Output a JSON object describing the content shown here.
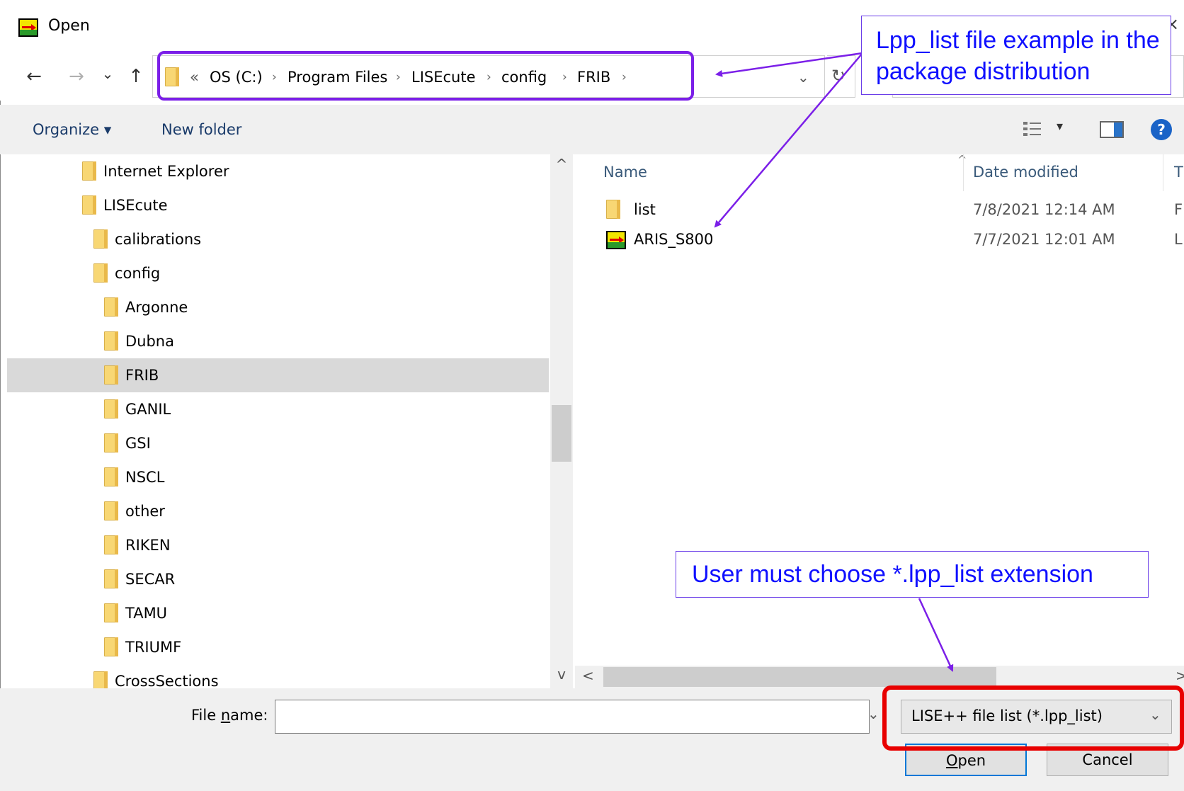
{
  "window": {
    "title": "Open",
    "close_glyph": "×"
  },
  "nav": {
    "back_glyph": "←",
    "forward_glyph": "→",
    "recent_glyph": "⌄",
    "up_glyph": "↑"
  },
  "address": {
    "overflow_glyph": "«",
    "separator_glyph": "›",
    "crumbs": [
      "OS (C:)",
      "Program Files",
      "LISEcute",
      "config",
      "FRIB"
    ],
    "dropdown_glyph": "⌄",
    "refresh_glyph": "↻"
  },
  "toolbar": {
    "organize_label": "Organize ▾",
    "new_folder_label": "New folder",
    "view_glyph": "▾",
    "help_glyph": "?"
  },
  "tree": {
    "items": [
      {
        "label": "Internet Explorer"
      },
      {
        "label": "LISEcute"
      },
      {
        "label": "calibrations"
      },
      {
        "label": "config"
      },
      {
        "label": "Argonne"
      },
      {
        "label": "Dubna"
      },
      {
        "label": "FRIB"
      },
      {
        "label": "GANIL"
      },
      {
        "label": "GSI"
      },
      {
        "label": "NSCL"
      },
      {
        "label": "other"
      },
      {
        "label": "RIKEN"
      },
      {
        "label": "SECAR"
      },
      {
        "label": "TAMU"
      },
      {
        "label": "TRIUMF"
      },
      {
        "label": "CrossSections"
      }
    ],
    "selected": "FRIB",
    "scroll_up_glyph": "^",
    "scroll_down_glyph": "v"
  },
  "files": {
    "columns": {
      "name": "Name",
      "date_modified": "Date modified",
      "type_partial": "T"
    },
    "sort_glyph": "^",
    "rows": [
      {
        "name": "list",
        "date": "7/8/2021 12:14 AM",
        "type_partial": "F",
        "icon": "folder-icon"
      },
      {
        "name": "ARIS_S800",
        "date": "7/7/2021 12:01 AM",
        "type_partial": "L",
        "icon": "lise-file-icon"
      }
    ],
    "hscroll_left_glyph": "<",
    "hscroll_right_glyph": ">"
  },
  "bottom": {
    "filename_label_pre": "File ",
    "filename_label_u": "n",
    "filename_label_post": "ame:",
    "filename_value": "",
    "filename_dropdown_glyph": "⌄",
    "filetype_value": "LISE++ file list (*.lpp_list)",
    "filetype_dropdown_glyph": "⌄",
    "open_u": "O",
    "open_rest": "pen",
    "cancel_label": "Cancel"
  },
  "annotations": {
    "callout_top": "Lpp_list file example in the package distribution",
    "callout_bottom": "User must choose *.lpp_list extension",
    "arrow_color": "#7b1fe8",
    "red_highlight_color": "#e80000"
  }
}
